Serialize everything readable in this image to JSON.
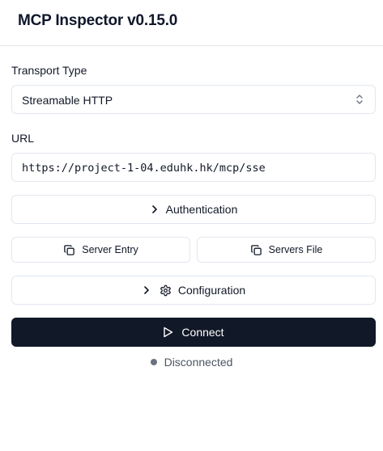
{
  "header": {
    "title": "MCP Inspector v0.15.0"
  },
  "transport": {
    "label": "Transport Type",
    "value": "Streamable HTTP"
  },
  "url": {
    "label": "URL",
    "value": "https://project-1-04.eduhk.hk/mcp/sse"
  },
  "buttons": {
    "authentication": "Authentication",
    "server_entry": "Server Entry",
    "servers_file": "Servers File",
    "configuration": "Configuration",
    "connect": "Connect"
  },
  "status": {
    "text": "Disconnected",
    "dot_color": "#6b7280"
  },
  "colors": {
    "primary_button": "#111827",
    "border": "#e2e8f0"
  }
}
